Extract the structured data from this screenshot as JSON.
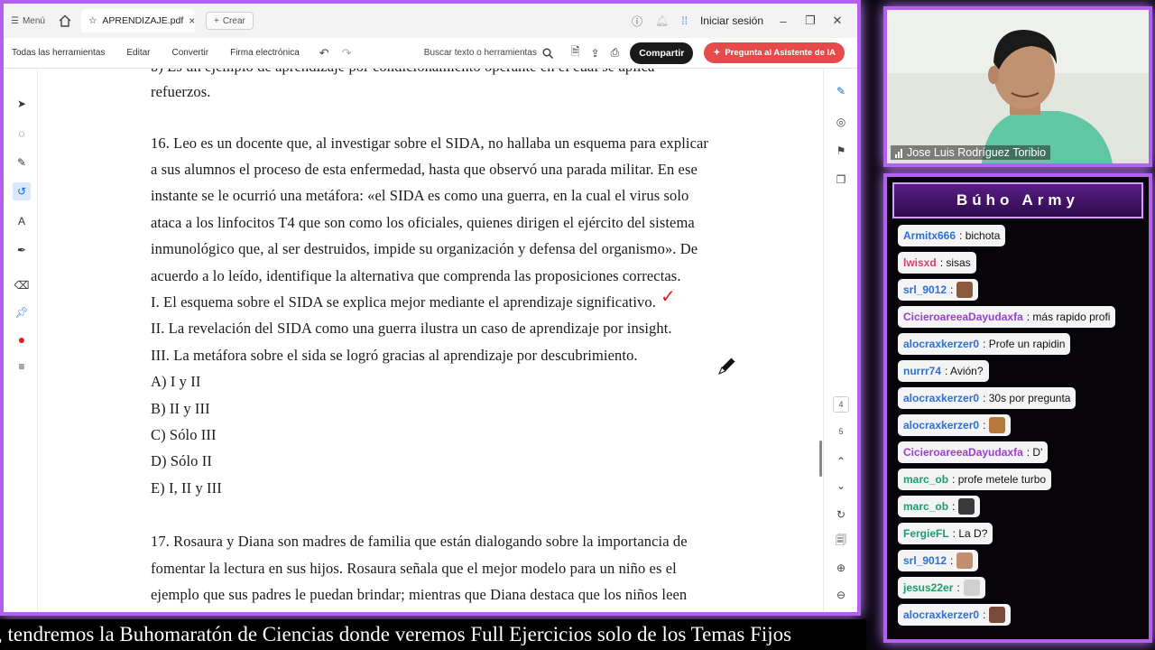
{
  "titlebar": {
    "menu_label": "Menú",
    "tab_title": "APRENDIZAJE.pdf",
    "new_tab_label": "Crear",
    "signin_label": "Iniciar sesión"
  },
  "toolbar": {
    "items": [
      "Todas las herramientas",
      "Editar",
      "Convertir",
      "Firma electrónica"
    ],
    "search_label": "Buscar texto o herramientas",
    "share_label": "Compartir",
    "ai_label": "Pregunta al Asistente de IA"
  },
  "pager": {
    "page_current": "4",
    "page_next": "5"
  },
  "document": {
    "lines": [
      "b) Es un ejemplo de aprendizaje por condicionamiento operante en el cual se aplica",
      "refuerzos.",
      "16. Leo es un docente que, al investigar sobre el SIDA, no hallaba un esquema para explicar",
      "a sus alumnos el proceso de esta enfermedad, hasta que observó una parada militar. En ese",
      "instante se le ocurrió una metáfora: «el SIDA es como una guerra, en la cual el virus solo",
      "ataca a los linfocitos T4 que son como los oficiales, quienes dirigen el ejército del sistema",
      "inmunológico que, al ser destruidos, impide su organización y defensa del organismo». De",
      "acuerdo a lo leído, identifique la alternativa que comprenda las proposiciones correctas.",
      "I. El esquema sobre el SIDA se explica mejor mediante el aprendizaje significativo.",
      "II. La revelación del SIDA como una guerra ilustra un caso de aprendizaje por insight.",
      "III. La metáfora sobre el sida se logró gracias al aprendizaje por descubrimiento.",
      "A) I y II",
      "B) II y III",
      "C) Sólo III",
      "D) Sólo II",
      "E) I, II y III",
      "17. Rosaura y Diana son madres de familia que están dialogando sobre la importancia de",
      "fomentar la lectura en sus hijos. Rosaura señala que el mejor modelo para un niño es el",
      "ejemplo que sus padres le puedan brindar; mientras que Diana destaca que los niños leen"
    ],
    "check_mark": "✓"
  },
  "webcam": {
    "name": "Jose Luis Rodríguez Toribio"
  },
  "chat": {
    "title": "Búho Army",
    "messages": [
      {
        "user": "Armitx666",
        "text": ": bichota",
        "color": "#2e6fd6"
      },
      {
        "user": "lwisxd",
        "text": ": sisas",
        "color": "#d8426a"
      },
      {
        "user": "srl_9012",
        "text": ":",
        "color": "#2e6fd6",
        "emote": "#8a5a3c"
      },
      {
        "user": "CicieroareeaDayudaxfa",
        "text": ": más rapido profi",
        "color": "#9a3fd0"
      },
      {
        "user": "alocraxkerzer0",
        "text": ": Profe un rapidin",
        "color": "#2e6fd6"
      },
      {
        "user": "nurrr74",
        "text": ": Avión?",
        "color": "#2e6fd6"
      },
      {
        "user": "alocraxkerzer0",
        "text": ": 30s por pregunta",
        "color": "#2e6fd6"
      },
      {
        "user": "alocraxkerzer0",
        "text": ":",
        "color": "#2e6fd6",
        "emote": "#b8773a"
      },
      {
        "user": "CicieroareeaDayudaxfa",
        "text": ": D'",
        "color": "#9a3fd0"
      },
      {
        "user": "marc_ob",
        "text": ": profe metele turbo",
        "color": "#1a9e6a"
      },
      {
        "user": "marc_ob",
        "text": ":",
        "color": "#1a9e6a",
        "emote": "#3a3a3a"
      },
      {
        "user": "FergieFL",
        "text": ": La D?",
        "color": "#1a9e6a"
      },
      {
        "user": "srl_9012",
        "text": ":",
        "color": "#2e6fd6",
        "emote": "#c09070"
      },
      {
        "user": "jesus22er",
        "text": ":",
        "color": "#1a9e6a",
        "emote": "#d0d0d0"
      },
      {
        "user": "alocraxkerzer0",
        "text": ":",
        "color": "#2e6fd6",
        "emote": "#7a4a3a"
      }
    ]
  },
  "ticker": {
    "text": ", tendremos la Buhomaratón de Ciencias donde veremos Full Ejercicios solo de los Temas Fijos"
  }
}
